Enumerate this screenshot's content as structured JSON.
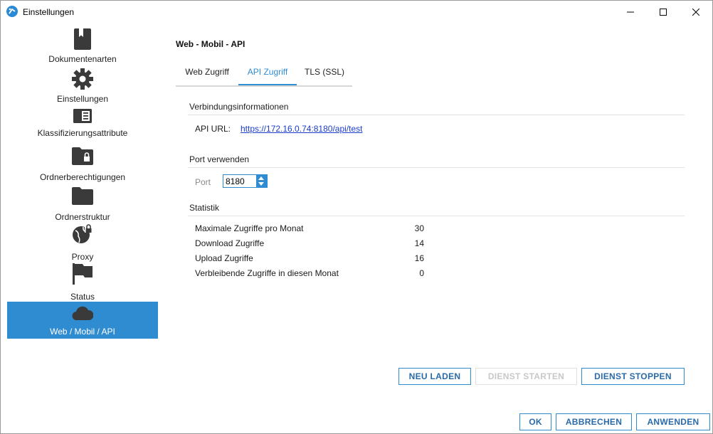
{
  "window": {
    "title": "Einstellungen"
  },
  "sidebar": {
    "items": [
      {
        "label": "Dokumentenarten",
        "icon": "bookmark-book-icon"
      },
      {
        "label": "Einstellungen",
        "icon": "gear-icon"
      },
      {
        "label": "Klassifizierungsattribute",
        "icon": "list-card-icon"
      },
      {
        "label": "Ordnerberechtigungen",
        "icon": "folder-lock-icon"
      },
      {
        "label": "Ordnerstruktur",
        "icon": "folder-icon"
      },
      {
        "label": "Proxy",
        "icon": "globe-lock-icon"
      },
      {
        "label": "Status",
        "icon": "flag-icon"
      },
      {
        "label": "Web / Mobil / API",
        "icon": "cloud-icon",
        "active": true
      }
    ]
  },
  "main": {
    "heading": "Web - Mobil - API",
    "tabs": [
      {
        "label": "Web Zugriff"
      },
      {
        "label": "API Zugriff",
        "active": true
      },
      {
        "label": "TLS (SSL)"
      }
    ],
    "connection": {
      "title": "Verbindungsinformationen",
      "api_url_label": "API URL:",
      "api_url": "https://172.16.0.74:8180/api/test"
    },
    "port": {
      "title": "Port verwenden",
      "label": "Port",
      "value": "8180"
    },
    "stats": {
      "title": "Statistik",
      "rows": [
        {
          "label": "Maximale Zugriffe pro Monat",
          "value": "30"
        },
        {
          "label": "Download Zugriffe",
          "value": "14"
        },
        {
          "label": "Upload Zugriffe",
          "value": "16"
        },
        {
          "label": "Verbleibende Zugriffe in diesen Monat",
          "value": "0"
        }
      ]
    },
    "actions": {
      "reload": "NEU LADEN",
      "start": "DIENST STARTEN",
      "stop": "DIENST STOPPEN"
    }
  },
  "footer": {
    "ok": "OK",
    "cancel": "ABBRECHEN",
    "apply": "ANWENDEN"
  },
  "colors": {
    "accent": "#2f8cd0",
    "icon": "#3a3a3a",
    "link": "#1a3ccc"
  }
}
